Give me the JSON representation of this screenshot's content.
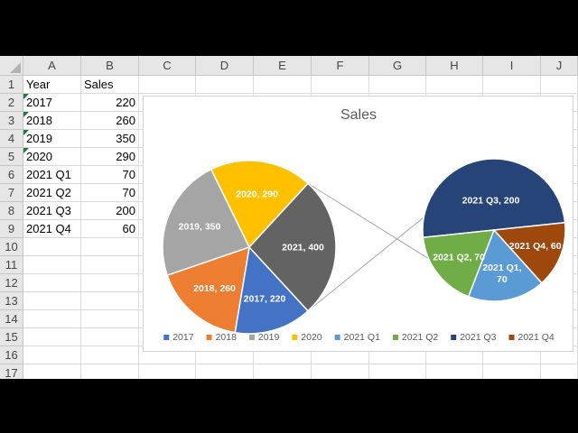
{
  "columns": [
    "A",
    "B",
    "C",
    "D",
    "E",
    "F",
    "G",
    "H",
    "I",
    "J"
  ],
  "rows": [
    "1",
    "2",
    "3",
    "4",
    "5",
    "6",
    "7",
    "8",
    "9",
    "10",
    "11",
    "12",
    "13",
    "14",
    "15",
    "16",
    "17"
  ],
  "table": {
    "header": [
      "Year",
      "Sales"
    ],
    "data": [
      [
        "2017",
        "220"
      ],
      [
        "2018",
        "260"
      ],
      [
        "2019",
        "350"
      ],
      [
        "2020",
        "290"
      ],
      [
        "2021 Q1",
        "70"
      ],
      [
        "2021 Q2",
        "70"
      ],
      [
        "2021 Q3",
        "200"
      ],
      [
        "2021 Q4",
        "60"
      ]
    ]
  },
  "chart_data": {
    "type": "pie",
    "title": "Sales",
    "legend_position": "bottom",
    "main": [
      {
        "label": "2017",
        "value": 220,
        "color": "#4472C4",
        "data_label": "2017, 220"
      },
      {
        "label": "2018",
        "value": 260,
        "color": "#ED7D31",
        "data_label": "2018, 260"
      },
      {
        "label": "2019",
        "value": 350,
        "color": "#A5A5A5",
        "data_label": "2019, 350"
      },
      {
        "label": "2020",
        "value": 290,
        "color": "#FFC000",
        "data_label": "2020, 290"
      },
      {
        "label": "2021",
        "value": 400,
        "color": "#636363",
        "data_label": "2021, 400"
      }
    ],
    "secondary": [
      {
        "label": "2021 Q1",
        "value": 70,
        "color": "#5B9BD5",
        "data_label": "2021 Q1, 70"
      },
      {
        "label": "2021 Q2",
        "value": 70,
        "color": "#70AD47",
        "data_label": "2021 Q2, 70"
      },
      {
        "label": "2021 Q3",
        "value": 200,
        "color": "#264478",
        "data_label": "2021 Q3, 200"
      },
      {
        "label": "2021 Q4",
        "value": 60,
        "color": "#9E480E",
        "data_label": "2021 Q4, 60"
      }
    ],
    "legend": [
      {
        "label": "2017",
        "color": "#4472C4"
      },
      {
        "label": "2018",
        "color": "#ED7D31"
      },
      {
        "label": "2019",
        "color": "#A5A5A5"
      },
      {
        "label": "2020",
        "color": "#FFC000"
      },
      {
        "label": "2021 Q1",
        "color": "#5B9BD5"
      },
      {
        "label": "2021 Q2",
        "color": "#70AD47"
      },
      {
        "label": "2021 Q3",
        "color": "#264478"
      },
      {
        "label": "2021 Q4",
        "color": "#9E480E"
      }
    ]
  }
}
